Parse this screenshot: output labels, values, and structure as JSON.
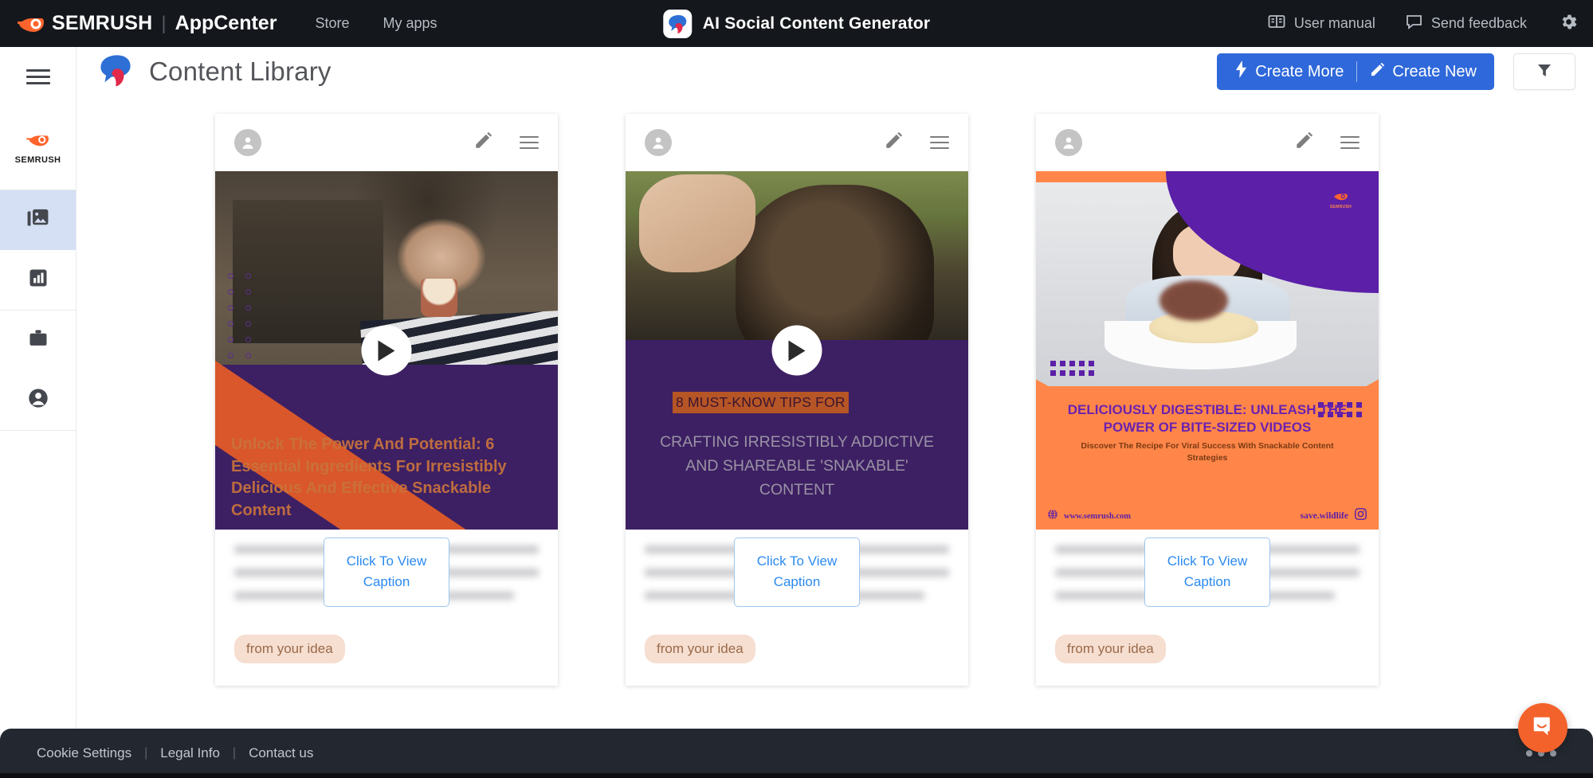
{
  "topbar": {
    "brand": "SEMRUSH",
    "brand_sub": "AppCenter",
    "nav": [
      {
        "label": "Store",
        "name": "topnav-store"
      },
      {
        "label": "My apps",
        "name": "topnav-my-apps"
      }
    ],
    "app_title": "AI Social Content Generator",
    "right_items": [
      {
        "label": "User manual",
        "icon": "book-icon"
      },
      {
        "label": "Send feedback",
        "icon": "comment-icon"
      }
    ],
    "settings_icon": "gear-icon"
  },
  "sidebar": {
    "menu_icon": "hamburger-menu-icon",
    "logo_label": "SEMRUSH",
    "items": [
      {
        "name": "sidebar-item-content-library",
        "icon": "images-icon",
        "active": true
      },
      {
        "name": "sidebar-item-analytics",
        "icon": "bar-chart-icon",
        "active": false
      },
      {
        "name": "sidebar-item-projects",
        "icon": "briefcase-icon",
        "active": false
      },
      {
        "name": "sidebar-item-account",
        "icon": "user-circle-icon",
        "active": false
      }
    ]
  },
  "header": {
    "title": "Content Library",
    "create_more_label": "Create More",
    "create_new_label": "Create New",
    "create_more_icon": "lightning-bolt-icon",
    "create_new_icon": "pencil-icon",
    "filter_icon": "funnel-icon"
  },
  "cards": [
    {
      "name": "content-card-1",
      "avatar_icon": "user-avatar-icon",
      "edit_icon": "pencil-icon",
      "menu_icon": "hamburger-menu-icon",
      "play_icon": "play-icon",
      "overlay_text": "Unlock The Power And Potential: 6 Essential Ingredients For Irresistibly Delicious And Effective Snackable Content",
      "caption_button": "Click To View Caption",
      "tag": "from your idea"
    },
    {
      "name": "content-card-2",
      "avatar_icon": "user-avatar-icon",
      "edit_icon": "pencil-icon",
      "menu_icon": "hamburger-menu-icon",
      "play_icon": "play-icon",
      "highlight_text": "8 MUST-KNOW TIPS FOR",
      "overlay_text": "CRAFTING IRRESISTIBLY ADDICTIVE AND SHAREABLE 'SNAKABLE' CONTENT",
      "caption_button": "Click To View Caption",
      "tag": "from your idea"
    },
    {
      "name": "content-card-3",
      "avatar_icon": "user-avatar-icon",
      "edit_icon": "pencil-icon",
      "menu_icon": "hamburger-menu-icon",
      "title_text": "DELICIOUSLY DIGESTIBLE: UNLEASH THE POWER OF BITE-SIZED VIDEOS",
      "subtitle_text": "Discover The Recipe For Viral Success With Snackable Content Strategies",
      "brand_label": "SEMRUSH",
      "website": "www.semrush.com",
      "handle": "save.wildlife",
      "globe_icon": "globe-icon",
      "instagram_icon": "instagram-icon",
      "caption_button": "Click To View Caption",
      "tag": "from your idea"
    }
  ],
  "footer": {
    "links": [
      {
        "label": "Cookie Settings",
        "name": "footer-link-cookie-settings"
      },
      {
        "label": "Legal Info",
        "name": "footer-link-legal-info"
      },
      {
        "label": "Contact us",
        "name": "footer-link-contact-us"
      }
    ],
    "separator": "|"
  },
  "chat": {
    "icon": "chat-bubble-icon"
  },
  "colors": {
    "topbar_bg": "#14171c",
    "accent_blue": "#2e68da",
    "sidebar_active": "#d6e0f5",
    "brand_orange": "#ff642d",
    "tag_bg": "#f6ded0",
    "footer_bg": "#232830"
  }
}
